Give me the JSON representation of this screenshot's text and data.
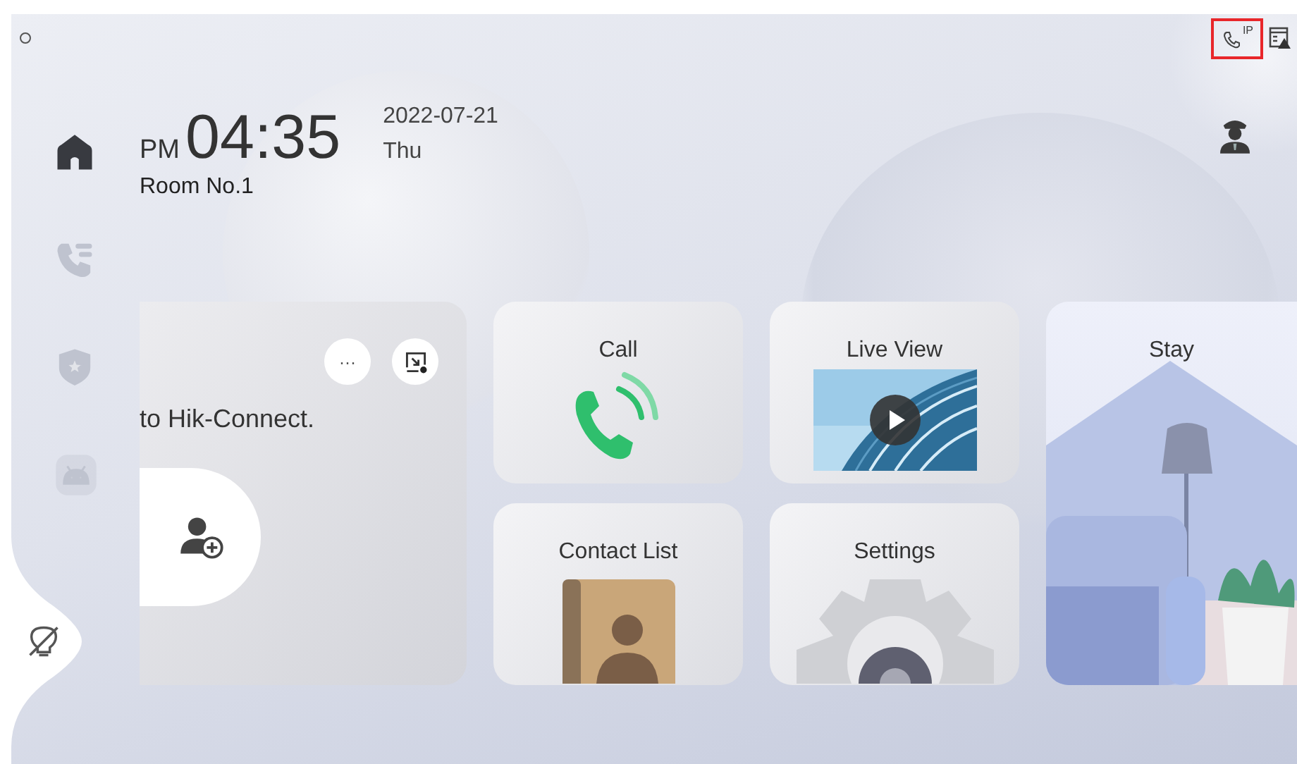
{
  "status_bar": {
    "ip_label": "IP",
    "highlighted": true
  },
  "clock": {
    "period": "PM",
    "time": "04:35",
    "date": "2022-07-21",
    "weekday": "Thu",
    "room": "Room No.1"
  },
  "sidebar": {
    "items": [
      {
        "kind": "home",
        "selected": true
      },
      {
        "kind": "call-log",
        "selected": false
      },
      {
        "kind": "security",
        "selected": false
      },
      {
        "kind": "android",
        "selected": false
      }
    ]
  },
  "cards": [
    {
      "kind": "hik",
      "text": "to Hik-Connect.",
      "more_label": "···"
    },
    {
      "kind": "call",
      "label": "Call"
    },
    {
      "kind": "live",
      "label": "Live View"
    },
    {
      "kind": "stay",
      "label": "Stay"
    },
    {
      "kind": "contacts",
      "label": "Contact List"
    },
    {
      "kind": "settings",
      "label": "Settings"
    }
  ]
}
